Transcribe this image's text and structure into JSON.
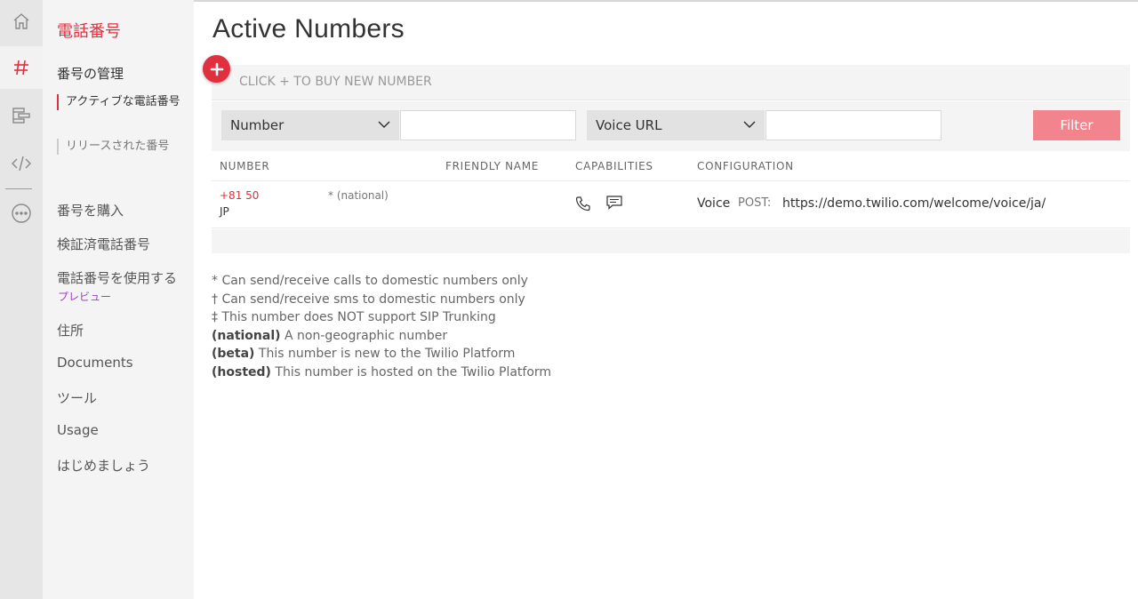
{
  "rail": {
    "items": [
      {
        "name": "home-icon"
      },
      {
        "name": "hash-icon",
        "color": "#e0303f"
      },
      {
        "name": "flow-icon"
      },
      {
        "name": "code-icon"
      },
      {
        "name": "more-icon"
      }
    ]
  },
  "sidebar": {
    "title": "電話番号",
    "section": "番号の管理",
    "sub_items": [
      {
        "label": "アクティブな電話番号",
        "active": true
      },
      {
        "label": "リリースされた番号",
        "active": false
      }
    ],
    "links": [
      {
        "label": "番号を購入"
      },
      {
        "label": "検証済電話番号"
      },
      {
        "label": "電話番号を使用する"
      },
      {
        "label": "住所"
      },
      {
        "label": "Documents"
      },
      {
        "label": "ツール"
      },
      {
        "label": "Usage"
      },
      {
        "label": "はじめましょう"
      }
    ],
    "preview_badge": "プレビュー"
  },
  "main": {
    "title": "Active Numbers",
    "buy_hint": "CLICK + TO BUY NEW NUMBER",
    "filters": {
      "field1": "Number",
      "field1_value": "",
      "field2": "Voice URL",
      "field2_value": "",
      "button": "Filter"
    },
    "columns": [
      "NUMBER",
      "FRIENDLY NAME",
      "CAPABILITIES",
      "CONFIGURATION"
    ],
    "rows": [
      {
        "number": "+81 50",
        "country": "JP",
        "note": "* (national)",
        "friendly_name": "",
        "capabilities": [
          "phone-icon",
          "sms-icon"
        ],
        "config_type": "Voice",
        "config_method": "POST:",
        "config_url": "https://demo.twilio.com/welcome/voice/ja/"
      }
    ],
    "legend": [
      {
        "prefix": "",
        "text": "* Can send/receive calls to domestic numbers only"
      },
      {
        "prefix": "",
        "text": "† Can send/receive sms to domestic numbers only"
      },
      {
        "prefix": "",
        "text": "‡ This number does NOT support SIP Trunking"
      },
      {
        "prefix": "(national)",
        "text": " A non-geographic number"
      },
      {
        "prefix": "(beta)",
        "text": " This number is new to the Twilio Platform"
      },
      {
        "prefix": "(hosted)",
        "text": " This number is hosted on the Twilio Platform"
      }
    ]
  },
  "colors": {
    "accent": "#e0303f",
    "filter_button": "#f2848d",
    "preview": "#a040c8"
  }
}
